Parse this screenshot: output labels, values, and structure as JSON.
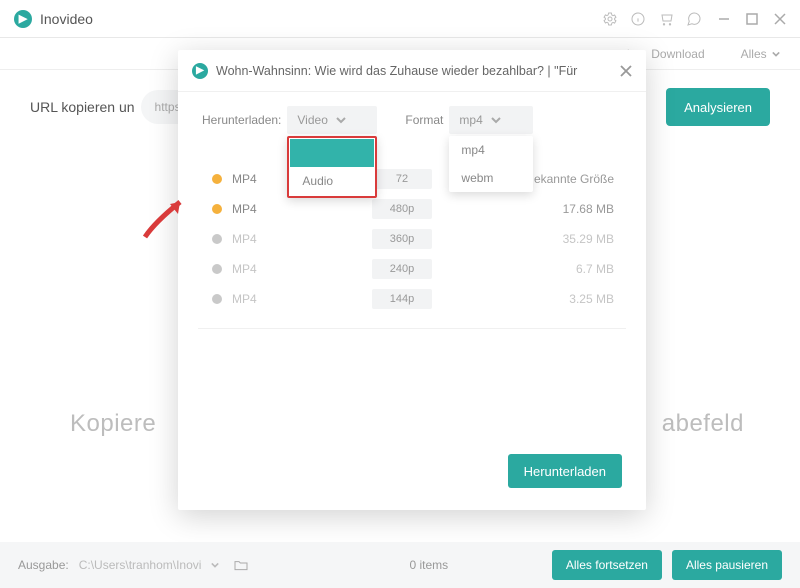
{
  "titlebar": {
    "app_name": "Inovideo"
  },
  "tabs": {
    "download": "Download",
    "alles": "Alles"
  },
  "url_section": {
    "label": "URL kopieren un",
    "input_value": "https://youtu.be/K",
    "analyze": "Analysieren"
  },
  "big_hint_left": "Kopiere",
  "big_hint_right": "abefeld",
  "bottom": {
    "ausgabe": "Ausgabe:",
    "path": "C:\\Users\\tranhom\\Inovi",
    "items": "0 items",
    "resume_all": "Alles fortsetzen",
    "pause_all": "Alles pausieren"
  },
  "dialog": {
    "title": "Wohn-Wahnsinn: Wie wird das Zuhause wieder bezahlbar? | \"Für",
    "herunterladen_label": "Herunterladen:",
    "format_label": "Format",
    "select_video": "Video",
    "select_format": "mp4",
    "video_options": {
      "video": "",
      "audio": "Audio"
    },
    "format_options": {
      "mp4": "mp4",
      "webm": "webm"
    },
    "rows": [
      {
        "format": "MP4",
        "res": "72",
        "size": "ekannte Größe",
        "gold": true
      },
      {
        "format": "MP4",
        "res": "480p",
        "size": "17.68 MB",
        "gold": true
      },
      {
        "format": "MP4",
        "res": "360p",
        "size": "35.29 MB",
        "gold": false
      },
      {
        "format": "MP4",
        "res": "240p",
        "size": "6.7 MB",
        "gold": false
      },
      {
        "format": "MP4",
        "res": "144p",
        "size": "3.25 MB",
        "gold": false
      }
    ],
    "download_btn": "Herunterladen"
  }
}
